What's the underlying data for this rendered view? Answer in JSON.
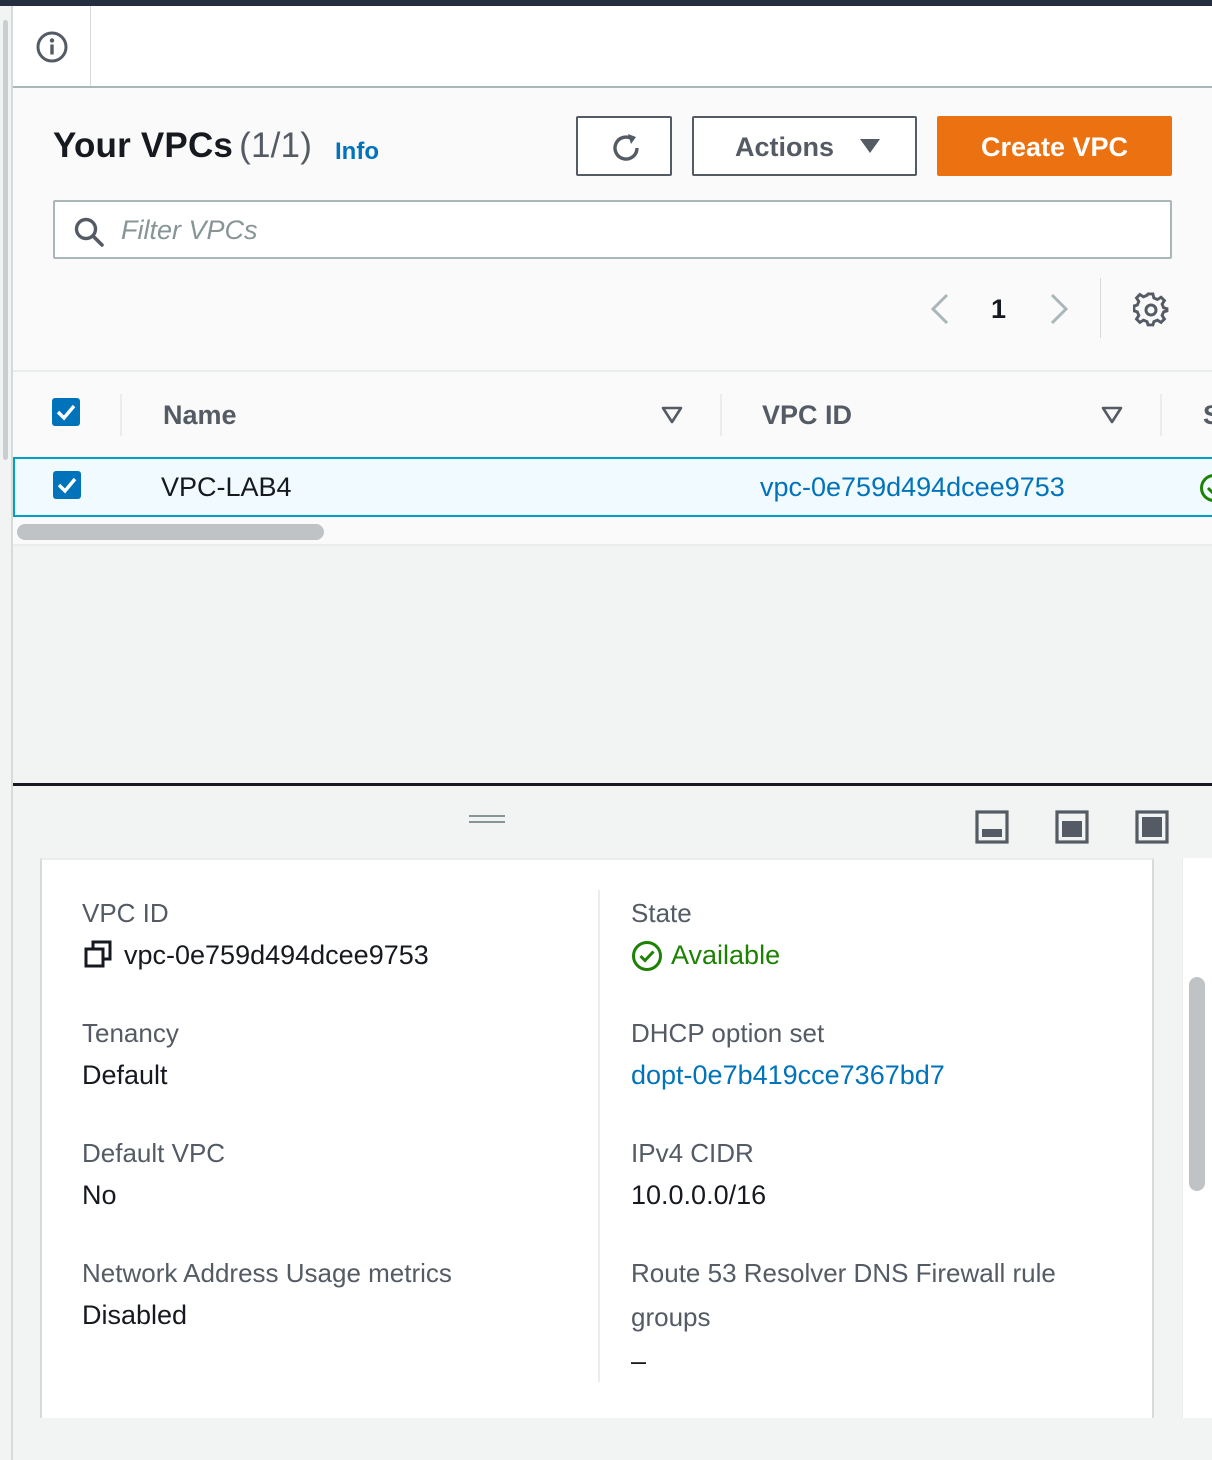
{
  "header": {
    "title": "Your VPCs",
    "count": "(1/1)",
    "info_link": "Info"
  },
  "toolbar": {
    "actions_label": "Actions",
    "create_label": "Create VPC"
  },
  "search": {
    "placeholder": "Filter VPCs"
  },
  "pagination": {
    "current_page": "1"
  },
  "table": {
    "columns": [
      "Name",
      "VPC ID",
      "S"
    ],
    "rows": [
      {
        "selected": true,
        "name": "VPC-LAB4",
        "vpc_id": "vpc-0e759d494dcee9753"
      }
    ]
  },
  "details": {
    "vpc_id_label": "VPC ID",
    "vpc_id_value": "vpc-0e759d494dcee9753",
    "state_label": "State",
    "state_value": "Available",
    "tenancy_label": "Tenancy",
    "tenancy_value": "Default",
    "dhcp_label": "DHCP option set",
    "dhcp_value": "dopt-0e7b419cce7367bd7",
    "default_vpc_label": "Default VPC",
    "default_vpc_value": "No",
    "ipv4_label": "IPv4 CIDR",
    "ipv4_value": "10.0.0.0/16",
    "nau_label": "Network Address Usage metrics",
    "nau_value": "Disabled",
    "route53_label_line1": "Route 53 Resolver DNS Firewall rule",
    "route53_label_line2": "groups",
    "route53_value": "–"
  },
  "colors": {
    "primary_button": "#ec7211",
    "link": "#0073bb",
    "success": "#1d8102",
    "selected_row_bg": "#f1faff",
    "selected_row_border": "#00a1c9"
  },
  "icons": [
    "info-icon",
    "refresh-icon",
    "caret-down-icon",
    "search-icon",
    "chevron-left-icon",
    "chevron-right-icon",
    "gear-icon",
    "checkbox-checked-icon",
    "sort-icon",
    "status-ok-icon",
    "copy-icon",
    "panel-bottom-icon",
    "panel-side-icon",
    "panel-full-icon"
  ]
}
